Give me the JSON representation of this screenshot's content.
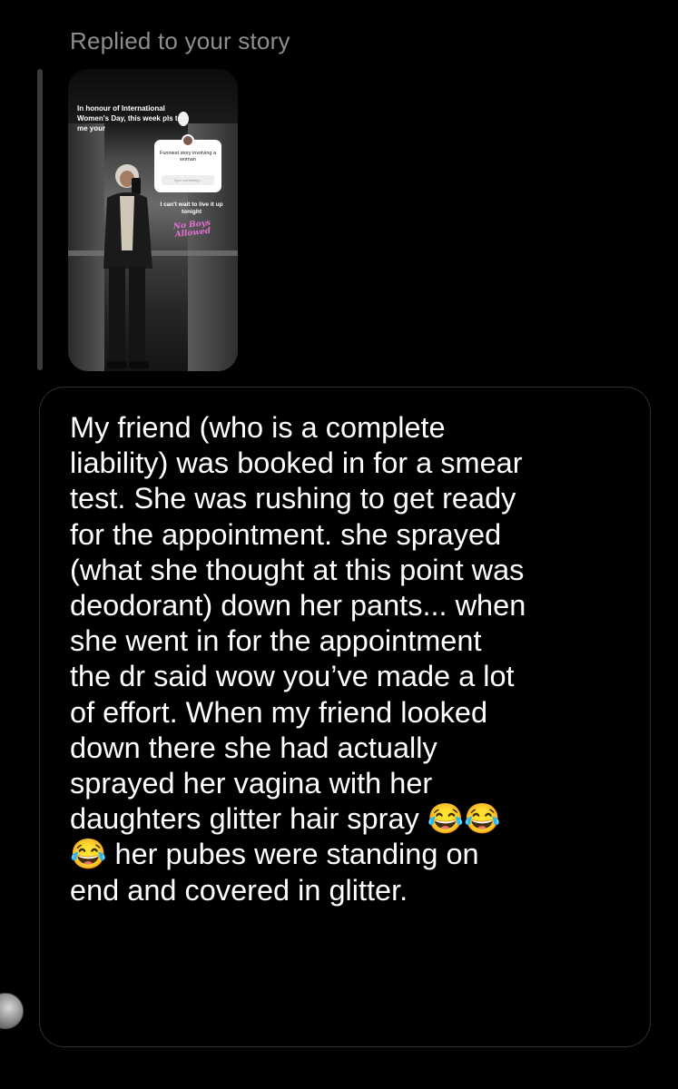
{
  "reply_context": {
    "label": "Replied to your story"
  },
  "story": {
    "caption_top": "In honour of International Women's Day, this week pls tell me your",
    "question_text": "Funniest story involving a woman",
    "question_placeholder": "Type something...",
    "caption_mid": "I can't wait to live it up tonight",
    "sticker_text": "No Boys Allowed"
  },
  "message": {
    "text": "My friend (who is a complete\nliability) was booked in for a smear\ntest. She was rushing to get ready\nfor the appointment. she sprayed\n(what she thought at this point was\ndeodorant) down her pants... when\nshe went in for the appointment\nthe dr said wow you’ve made a lot\nof effort. When my friend looked\ndown there she had actually\nsprayed her vagina with her\ndaughters glitter hair spray 😂😂\n😂 her pubes were standing on\nend and covered in glitter."
  },
  "colors": {
    "background": "#000000",
    "secondary_text": "#8e8e8e",
    "bubble_border": "#2f2f2f",
    "text": "#ffffff",
    "sticker": "#e86fd3"
  }
}
